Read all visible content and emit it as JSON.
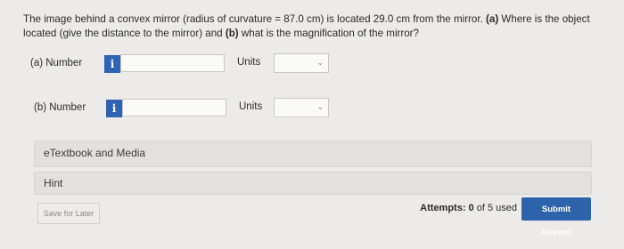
{
  "question": {
    "intro": "The image behind a convex mirror (radius of curvature = 87.0 cm) is located 29.0 cm from the mirror. ",
    "part_a_marker": "(a)",
    "part_a_text": " Where is the object located (give the distance to the mirror) and ",
    "part_b_marker": "(b)",
    "part_b_text": " what is the magnification of the mirror?"
  },
  "part_a": {
    "label": "(a)   Number",
    "info_icon": "i",
    "value": "",
    "units_label": "Units",
    "units_selected": ""
  },
  "part_b": {
    "label": "(b)   Number",
    "info_icon": "i",
    "value": "",
    "units_label": "Units",
    "units_selected": ""
  },
  "etextbook_label": "eTextbook and Media",
  "hint_label": "Hint",
  "save_label": "Save for Later",
  "attempts": {
    "prefix": "Attempts: ",
    "used": "0",
    "suffix": " of 5 used"
  },
  "submit_label": "Submit Answer",
  "colors": {
    "accent": "#2c63aa",
    "info_icon": "#2f63b4",
    "background": "#ecebe9"
  },
  "icons": {
    "info": "info-icon",
    "dropdown": "chevron-down-icon"
  }
}
